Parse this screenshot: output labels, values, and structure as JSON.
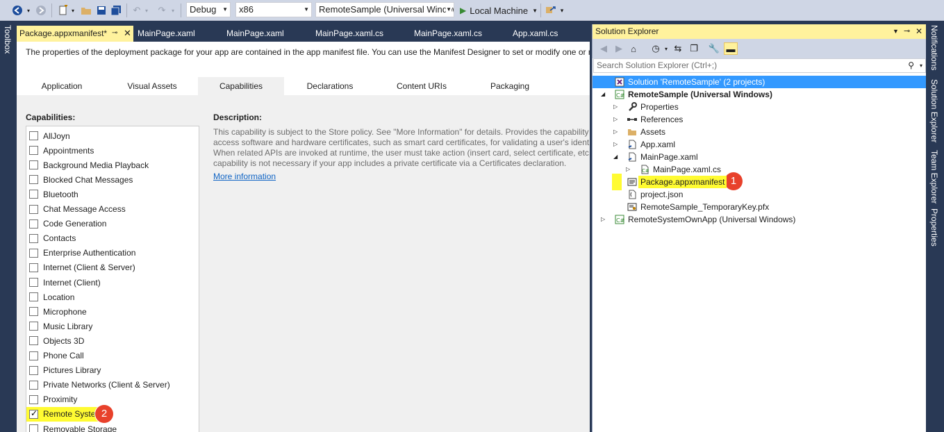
{
  "toolbar": {
    "config": "Debug",
    "platform": "x86",
    "startup_project": "RemoteSample (Universal Window",
    "run_target": "Local Machine"
  },
  "side_tabs": {
    "left": "Toolbox",
    "right": [
      "Notifications",
      "Solution Explorer",
      "Team Explorer",
      "Properties"
    ]
  },
  "doc_tabs": [
    {
      "label": "Package.appxmanifest*",
      "active": true
    },
    {
      "label": "MainPage.xaml"
    },
    {
      "label": "MainPage.xaml"
    },
    {
      "label": "MainPage.xaml.cs"
    },
    {
      "label": "MainPage.xaml.cs"
    },
    {
      "label": "App.xaml.cs"
    }
  ],
  "manifest": {
    "intro": "The properties of the deployment package for your app are contained in the app manifest file. You can use the Manifest Designer to set or modify one or m",
    "tabs": [
      "Application",
      "Visual Assets",
      "Capabilities",
      "Declarations",
      "Content URIs",
      "Packaging"
    ],
    "active_tab": "Capabilities",
    "capabilities_heading": "Capabilities:",
    "capabilities": [
      {
        "label": "AllJoyn",
        "checked": false
      },
      {
        "label": "Appointments",
        "checked": false
      },
      {
        "label": "Background Media Playback",
        "checked": false
      },
      {
        "label": "Blocked Chat Messages",
        "checked": false
      },
      {
        "label": "Bluetooth",
        "checked": false
      },
      {
        "label": "Chat Message Access",
        "checked": false
      },
      {
        "label": "Code Generation",
        "checked": false
      },
      {
        "label": "Contacts",
        "checked": false
      },
      {
        "label": "Enterprise Authentication",
        "checked": false
      },
      {
        "label": "Internet (Client & Server)",
        "checked": false
      },
      {
        "label": "Internet (Client)",
        "checked": false
      },
      {
        "label": "Location",
        "checked": false
      },
      {
        "label": "Microphone",
        "checked": false
      },
      {
        "label": "Music Library",
        "checked": false
      },
      {
        "label": "Objects 3D",
        "checked": false
      },
      {
        "label": "Phone Call",
        "checked": false
      },
      {
        "label": "Pictures Library",
        "checked": false
      },
      {
        "label": "Private Networks (Client & Server)",
        "checked": false
      },
      {
        "label": "Proximity",
        "checked": false
      },
      {
        "label": "Remote System",
        "checked": true,
        "highlighted": true
      },
      {
        "label": "Removable Storage",
        "checked": false
      }
    ],
    "description_heading": "Description:",
    "description_lines": [
      "This capability is subject to the Store policy. See \"More Information\" for details. Provides the capability t",
      "access software and hardware certificates, such as smart card certificates, for validating a user's identity.",
      "When related APIs are invoked at runtime, the user must take action (insert card, select certificate, etc.).",
      "capability is not necessary if your app includes a private certificate via a Certificates declaration."
    ],
    "more_info": "More information"
  },
  "solution_explorer": {
    "title": "Solution Explorer",
    "search_placeholder": "Search Solution Explorer (Ctrl+;)",
    "tree": [
      {
        "label": "Solution 'RemoteSample' (2 projects)",
        "level": 0,
        "icon": "solution-icon",
        "selected": true
      },
      {
        "label": "RemoteSample (Universal Windows)",
        "level": 0,
        "icon": "csharp-project-icon",
        "bold": true,
        "expanded": true
      },
      {
        "label": "Properties",
        "level": 1,
        "icon": "wrench-icon",
        "expander": "collapsed"
      },
      {
        "label": "References",
        "level": 1,
        "icon": "references-icon",
        "expander": "collapsed"
      },
      {
        "label": "Assets",
        "level": 1,
        "icon": "folder-icon",
        "expander": "collapsed"
      },
      {
        "label": "App.xaml",
        "level": 1,
        "icon": "xaml-file-icon",
        "expander": "collapsed"
      },
      {
        "label": "MainPage.xaml",
        "level": 1,
        "icon": "xaml-file-icon",
        "expander": "expanded"
      },
      {
        "label": "MainPage.xaml.cs",
        "level": 2,
        "icon": "csharp-file-icon",
        "expander": "collapsed"
      },
      {
        "label": "Package.appxmanifest",
        "level": 1,
        "icon": "manifest-icon",
        "highlighted": true
      },
      {
        "label": "project.json",
        "level": 1,
        "icon": "json-file-icon"
      },
      {
        "label": "RemoteSample_TemporaryKey.pfx",
        "level": 1,
        "icon": "certificate-icon"
      },
      {
        "label": "RemoteSystemOwnApp (Universal Windows)",
        "level": 0,
        "icon": "csharp-project-icon",
        "expander": "collapsed"
      }
    ]
  },
  "badges": {
    "one": "1",
    "two": "2"
  },
  "colors": {
    "highlight": "#fffb32",
    "tab_active": "#fff29d",
    "frame": "#293955",
    "badge": "#e8412b",
    "selected": "#3399ff"
  }
}
